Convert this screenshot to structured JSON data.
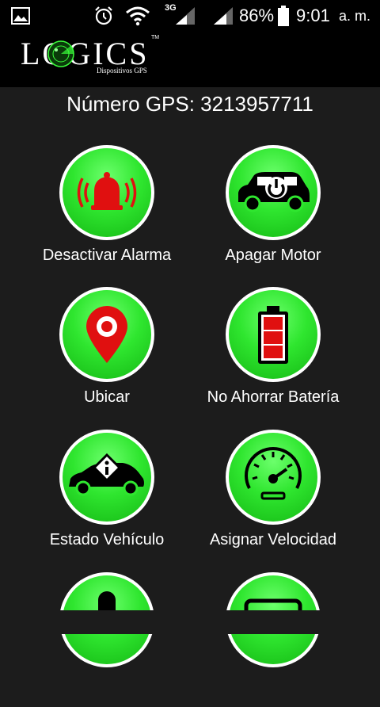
{
  "status_bar": {
    "battery_percent": "86%",
    "time": "9:01",
    "ampm": "a. m.",
    "network": "3G",
    "icons": [
      "image-icon",
      "alarm-clock-icon",
      "wifi-icon",
      "signal-icon",
      "signal-icon",
      "battery-icon"
    ]
  },
  "header": {
    "logo_text": "LOGICS",
    "logo_subtitle": "Dispositivos GPS",
    "logo_tm": "TM"
  },
  "main": {
    "gps_number_label": "Número GPS: 3213957711",
    "tiles": [
      {
        "label": "Desactivar Alarma",
        "icon": "alarm-bell-icon"
      },
      {
        "label": "Apagar Motor",
        "icon": "car-power-icon"
      },
      {
        "label": "Ubicar",
        "icon": "location-pin-icon"
      },
      {
        "label": "No Ahorrar Batería",
        "icon": "battery-icon"
      },
      {
        "label": "Estado Vehículo",
        "icon": "car-info-icon"
      },
      {
        "label": "Asignar Velocidad",
        "icon": "speedometer-icon"
      },
      {
        "label": "",
        "icon": "partial-icon"
      },
      {
        "label": "",
        "icon": "partial-icon"
      }
    ]
  },
  "colors": {
    "background": "#1c1c1c",
    "button_green": "#2fe62f",
    "icon_red": "#e01010"
  }
}
